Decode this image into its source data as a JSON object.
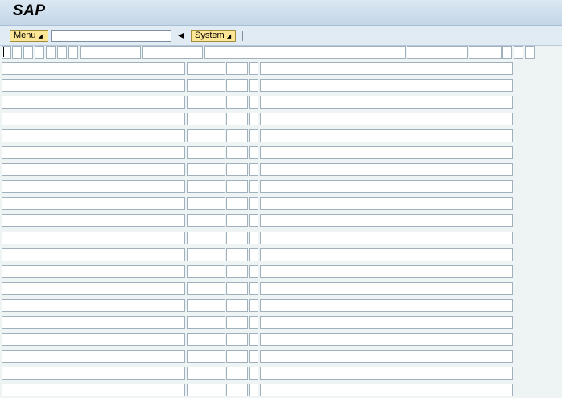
{
  "window": {
    "title": "SAP"
  },
  "toolbar": {
    "menu_label": "Menu",
    "system_label": "System",
    "command_value": "",
    "back_icon": "triangle-left-icon",
    "dropdown_icon": "triangle-down-icon"
  },
  "colors": {
    "background": "#eef4f4",
    "title_bar": "#c3d6e8",
    "button_fill": "#fde695",
    "field_border": "#a0b0bc"
  },
  "screen": {
    "header_field_count": 15,
    "row_count": 20,
    "row_field_count": 5
  }
}
